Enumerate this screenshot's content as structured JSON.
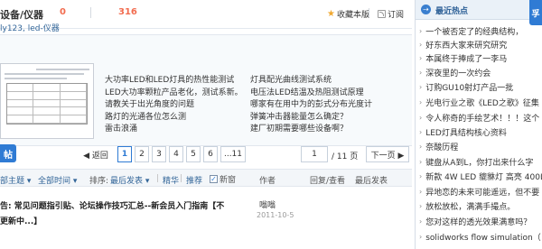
{
  "header": {
    "forum_title": "设备/仪器",
    "today_count": "0",
    "total_count": "316",
    "favorite": "收藏本版",
    "rss": "订阅",
    "moderators": "ly123, led-仪器"
  },
  "links": {
    "col1": [
      "大功率LED和LED灯具的热性能测试",
      "LED大功率颗粒产品老化，测试系新。",
      "请教关于出光角度的问题",
      "路灯的光通各位怎么测",
      "雷击浪涌"
    ],
    "col2": [
      "灯具配光曲线测试系统",
      "电压法LED结温及热阻测试原理",
      "哪家有在用中为的彭式分布光度计",
      "弹簧冲击器能量怎么确定？",
      "建厂初期需要哪些设备啊？"
    ]
  },
  "pager": {
    "post_label": "帖",
    "prev": "◀ 返回",
    "pages": [
      "1",
      "2",
      "3",
      "4",
      "5",
      "6",
      "...11"
    ],
    "current_page": "1",
    "total_pages": "/ 11 页",
    "next": "下一页 ▶"
  },
  "filters": {
    "all_topics": "部主题 ▾",
    "all_time": "全部时间 ▾",
    "sort_label": "排序:",
    "sort_value": "最后发表 ▾",
    "digest": "精华",
    "recommend": "推荐",
    "new_window": "新窗",
    "author_col": "作者",
    "reply_col": "回复/查看",
    "last_post_col": "最后发表"
  },
  "thread": {
    "title_line1": "告: 常见问题指引贴、论坛操作技巧汇总--新会员入门指南【不",
    "title_line2": "更新中...】",
    "author": "嗡嗡",
    "date": "2011-10-5"
  },
  "sidebar": {
    "tab": "孚",
    "title": "最近热点",
    "items": [
      "一个被否定了的经典结构，",
      "好东西大家来研究研究",
      "本属终于捧成了一李马",
      "深夜里的一次约会",
      "订购GU10射灯产品一批",
      "光电行业之歌《LED之歌》征集",
      "令人称奇的手绘艺术！！！这个",
      "LED灯具结构核心资料",
      "奈酸历程",
      "键盘从A到L，你打出来什么字",
      "新款 4W LED 貔貅灯 高亮 400L",
      "异地恋的未来可能遥远，但不要",
      "放松放松，满满手撮点。",
      "您对这样的透光效果满意吗？",
      "solidworks flow simulation（"
    ]
  },
  "colors": {
    "accent": "#2f7bd4",
    "count_orange": "#f26c4f",
    "link_blue": "#336699"
  }
}
